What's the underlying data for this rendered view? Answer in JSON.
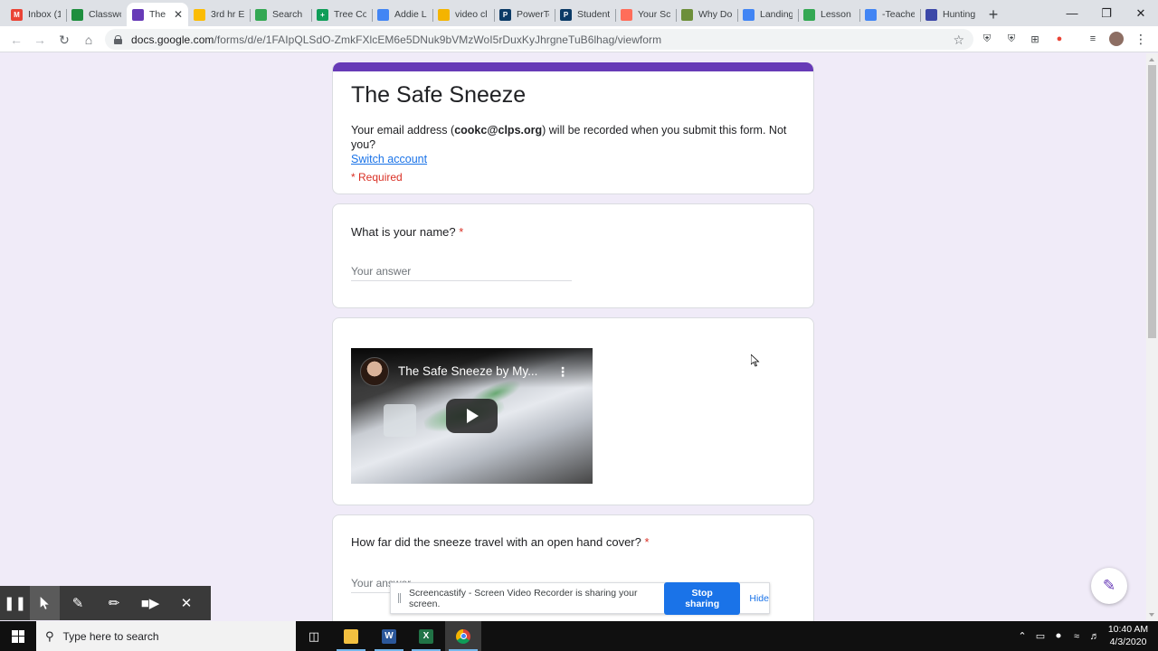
{
  "browser": {
    "tabs": [
      {
        "title": "Inbox (1",
        "icon": "gmail-icon",
        "color": "#ea4335",
        "glyph": "M",
        "width": 67
      },
      {
        "title": "Classwo",
        "icon": "classroom-icon",
        "color": "#1e8e3e",
        "glyph": "",
        "width": 67
      },
      {
        "title": "The",
        "icon": "forms-icon",
        "color": "#673ab7",
        "glyph": "",
        "width": 68,
        "active": true
      },
      {
        "title": "3rd hr E",
        "icon": "drive-icon",
        "color": "#fbbc04",
        "glyph": "",
        "width": 68
      },
      {
        "title": "Search",
        "icon": "drive-icon",
        "color": "#34a853",
        "glyph": "",
        "width": 68
      },
      {
        "title": "Tree Co",
        "icon": "sheets-icon",
        "color": "#0f9d58",
        "glyph": "+",
        "width": 67
      },
      {
        "title": "Addie L",
        "icon": "docs-icon",
        "color": "#4285f4",
        "glyph": "",
        "width": 67
      },
      {
        "title": "video cl",
        "icon": "slides-icon",
        "color": "#f4b400",
        "glyph": "",
        "width": 68
      },
      {
        "title": "PowerTe",
        "icon": "powerteacher-icon",
        "color": "#0b3a66",
        "glyph": "P",
        "width": 67
      },
      {
        "title": "Student",
        "icon": "powerschool-icon",
        "color": "#0b3a66",
        "glyph": "P",
        "width": 67
      },
      {
        "title": "Your Sc",
        "icon": "screencastify-icon",
        "color": "#ff6d5a",
        "glyph": "",
        "width": 67
      },
      {
        "title": "Why Do",
        "icon": "image-icon",
        "color": "#6d8f3a",
        "glyph": "",
        "width": 68
      },
      {
        "title": "Landing",
        "icon": "docs-icon",
        "color": "#4285f4",
        "glyph": "",
        "width": 67
      },
      {
        "title": "Lesson",
        "icon": "drive-icon",
        "color": "#34a853",
        "glyph": "",
        "width": 68
      },
      {
        "title": "-Teache",
        "icon": "docs-icon",
        "color": "#4285f4",
        "glyph": "",
        "width": 67
      },
      {
        "title": "Hunting",
        "icon": "circle-icon",
        "color": "#3c48a8",
        "glyph": "",
        "width": 67
      }
    ],
    "url": {
      "domain": "docs.google.com",
      "path": "/forms/d/e/1FAIpQLSdO-ZmkFXlcEM6e5DNuk9bVMzWoI5rDuxKyJhrgneTuB6lhag/viewform"
    }
  },
  "form": {
    "title": "The Safe Sneeze",
    "email_prefix": "Your email address (",
    "email": "cookc@clps.org",
    "email_suffix": ") will be recorded when you submit this form. Not you?",
    "switch_account": "Switch account",
    "required_note": "* Required",
    "questions": [
      {
        "title": "What is your name?",
        "required_mark": "*",
        "placeholder": "Your answer"
      },
      {
        "title": "How far did the sneeze travel with an open hand cover?",
        "required_mark": "*",
        "placeholder": "Your answer"
      }
    ],
    "video": {
      "title": "The Safe Sneeze by My..."
    }
  },
  "screencastify": {
    "message": "Screencastify - Screen Video Recorder is sharing your screen.",
    "stop_label": "Stop sharing",
    "hide_label": "Hide"
  },
  "taskbar": {
    "search_placeholder": "Type here to search",
    "time": "10:40 AM",
    "date": "4/3/2020"
  },
  "colors": {
    "form_accent": "#673ab7",
    "form_background": "#f0ebf8",
    "required_red": "#d93025",
    "link_blue": "#1a73e8"
  }
}
